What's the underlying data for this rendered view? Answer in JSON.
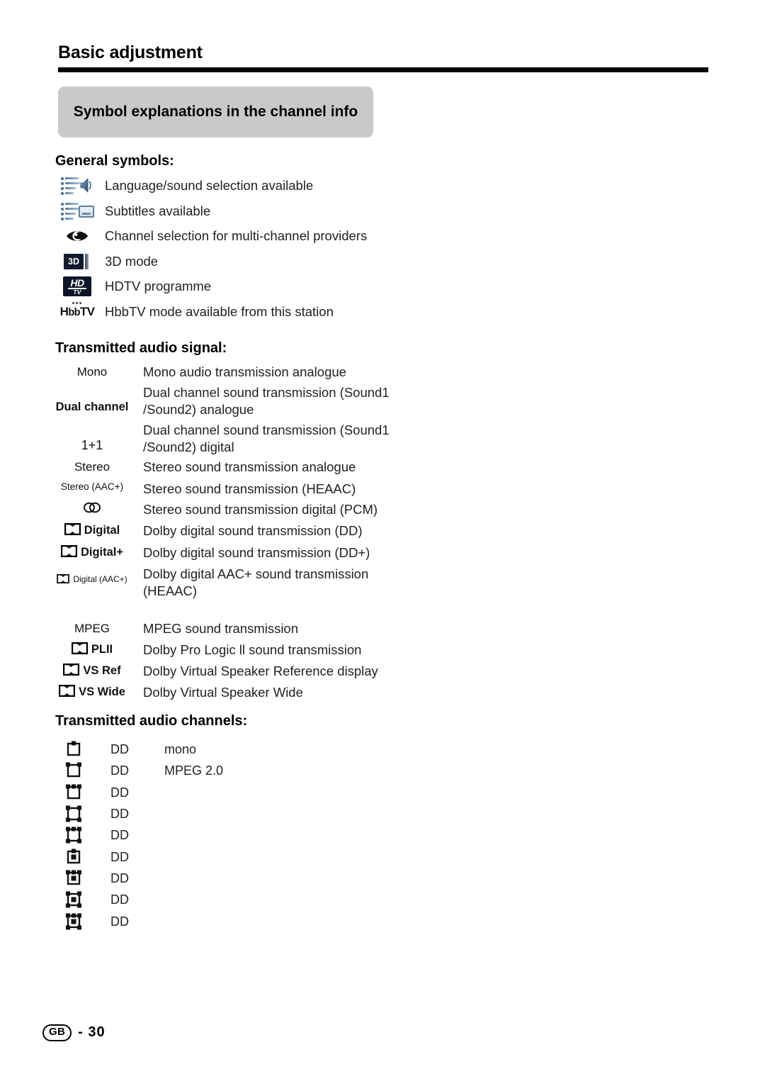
{
  "header": {
    "chapter": "Basic adjustment",
    "section_title": "Symbol explanations in the channel info"
  },
  "headings": {
    "general": "General symbols:",
    "audio_signal": "Transmitted audio signal:",
    "audio_channels": "Transmitted audio channels:"
  },
  "general_symbols": [
    {
      "icon": "language-sound-selection-icon",
      "text": "Language/sound selection available"
    },
    {
      "icon": "subtitles-icon",
      "text": "Subtitles available"
    },
    {
      "icon": "eye-icon",
      "text": "Channel selection for multi-channel providers"
    },
    {
      "icon": "3d-mode-icon",
      "text": "3D mode"
    },
    {
      "icon": "hdtv-icon",
      "text": "HDTV programme"
    },
    {
      "icon": "hbbtv-icon",
      "text": "HbbTV mode available from this station"
    }
  ],
  "audio_signal": [
    {
      "label": "Mono",
      "desc": "Mono audio transmission analogue"
    },
    {
      "label": "Dual channel",
      "desc": "Dual channel sound transmission (Sound1 /Sound2) analogue"
    },
    {
      "label": "1+1",
      "desc": "Dual channel sound transmission (Sound1 /Sound2) digital"
    },
    {
      "label": "Stereo",
      "desc": "Stereo sound transmission analogue"
    },
    {
      "label": "Stereo (AAC+)",
      "desc": "Stereo sound transmission (HEAAC)"
    },
    {
      "label": "",
      "desc": "Stereo sound transmission digital (PCM)"
    },
    {
      "label": "Digital",
      "desc": "Dolby digital sound transmission (DD)"
    },
    {
      "label": "Digital+",
      "desc": "Dolby digital sound transmission (DD+)"
    },
    {
      "label": "Digital (AAC+)",
      "desc": "Dolby digital AAC+ sound transmission (HEAAC)"
    },
    {
      "label": "MPEG",
      "desc": "MPEG sound transmission"
    },
    {
      "label": "PLII",
      "desc": "Dolby Pro Logic ll sound transmission"
    },
    {
      "label": "VS Ref",
      "desc": "Dolby Virtual Speaker Reference display"
    },
    {
      "label": "VS Wide",
      "desc": "Dolby Virtual Speaker Wide"
    }
  ],
  "audio_channels": [
    {
      "icon": "speaker-layout-1-icon",
      "format": "DD",
      "note": "mono"
    },
    {
      "icon": "speaker-layout-2-icon",
      "format": "DD",
      "note": "MPEG 2.0"
    },
    {
      "icon": "speaker-layout-3-icon",
      "format": "DD",
      "note": ""
    },
    {
      "icon": "speaker-layout-4-icon",
      "format": "DD",
      "note": ""
    },
    {
      "icon": "speaker-layout-5-icon",
      "format": "DD",
      "note": ""
    },
    {
      "icon": "speaker-layout-6-icon",
      "format": "DD",
      "note": ""
    },
    {
      "icon": "speaker-layout-7-icon",
      "format": "DD",
      "note": ""
    },
    {
      "icon": "speaker-layout-8-icon",
      "format": "DD",
      "note": ""
    },
    {
      "icon": "speaker-layout-9-icon",
      "format": "DD",
      "note": ""
    }
  ],
  "footer": {
    "region": "GB",
    "page": "- 30"
  },
  "colors": {
    "section_box_bg": "#c9c9c9",
    "rule": "#000000",
    "icon_blue": "#5b7e9e",
    "badge_dark": "#121a2e"
  }
}
